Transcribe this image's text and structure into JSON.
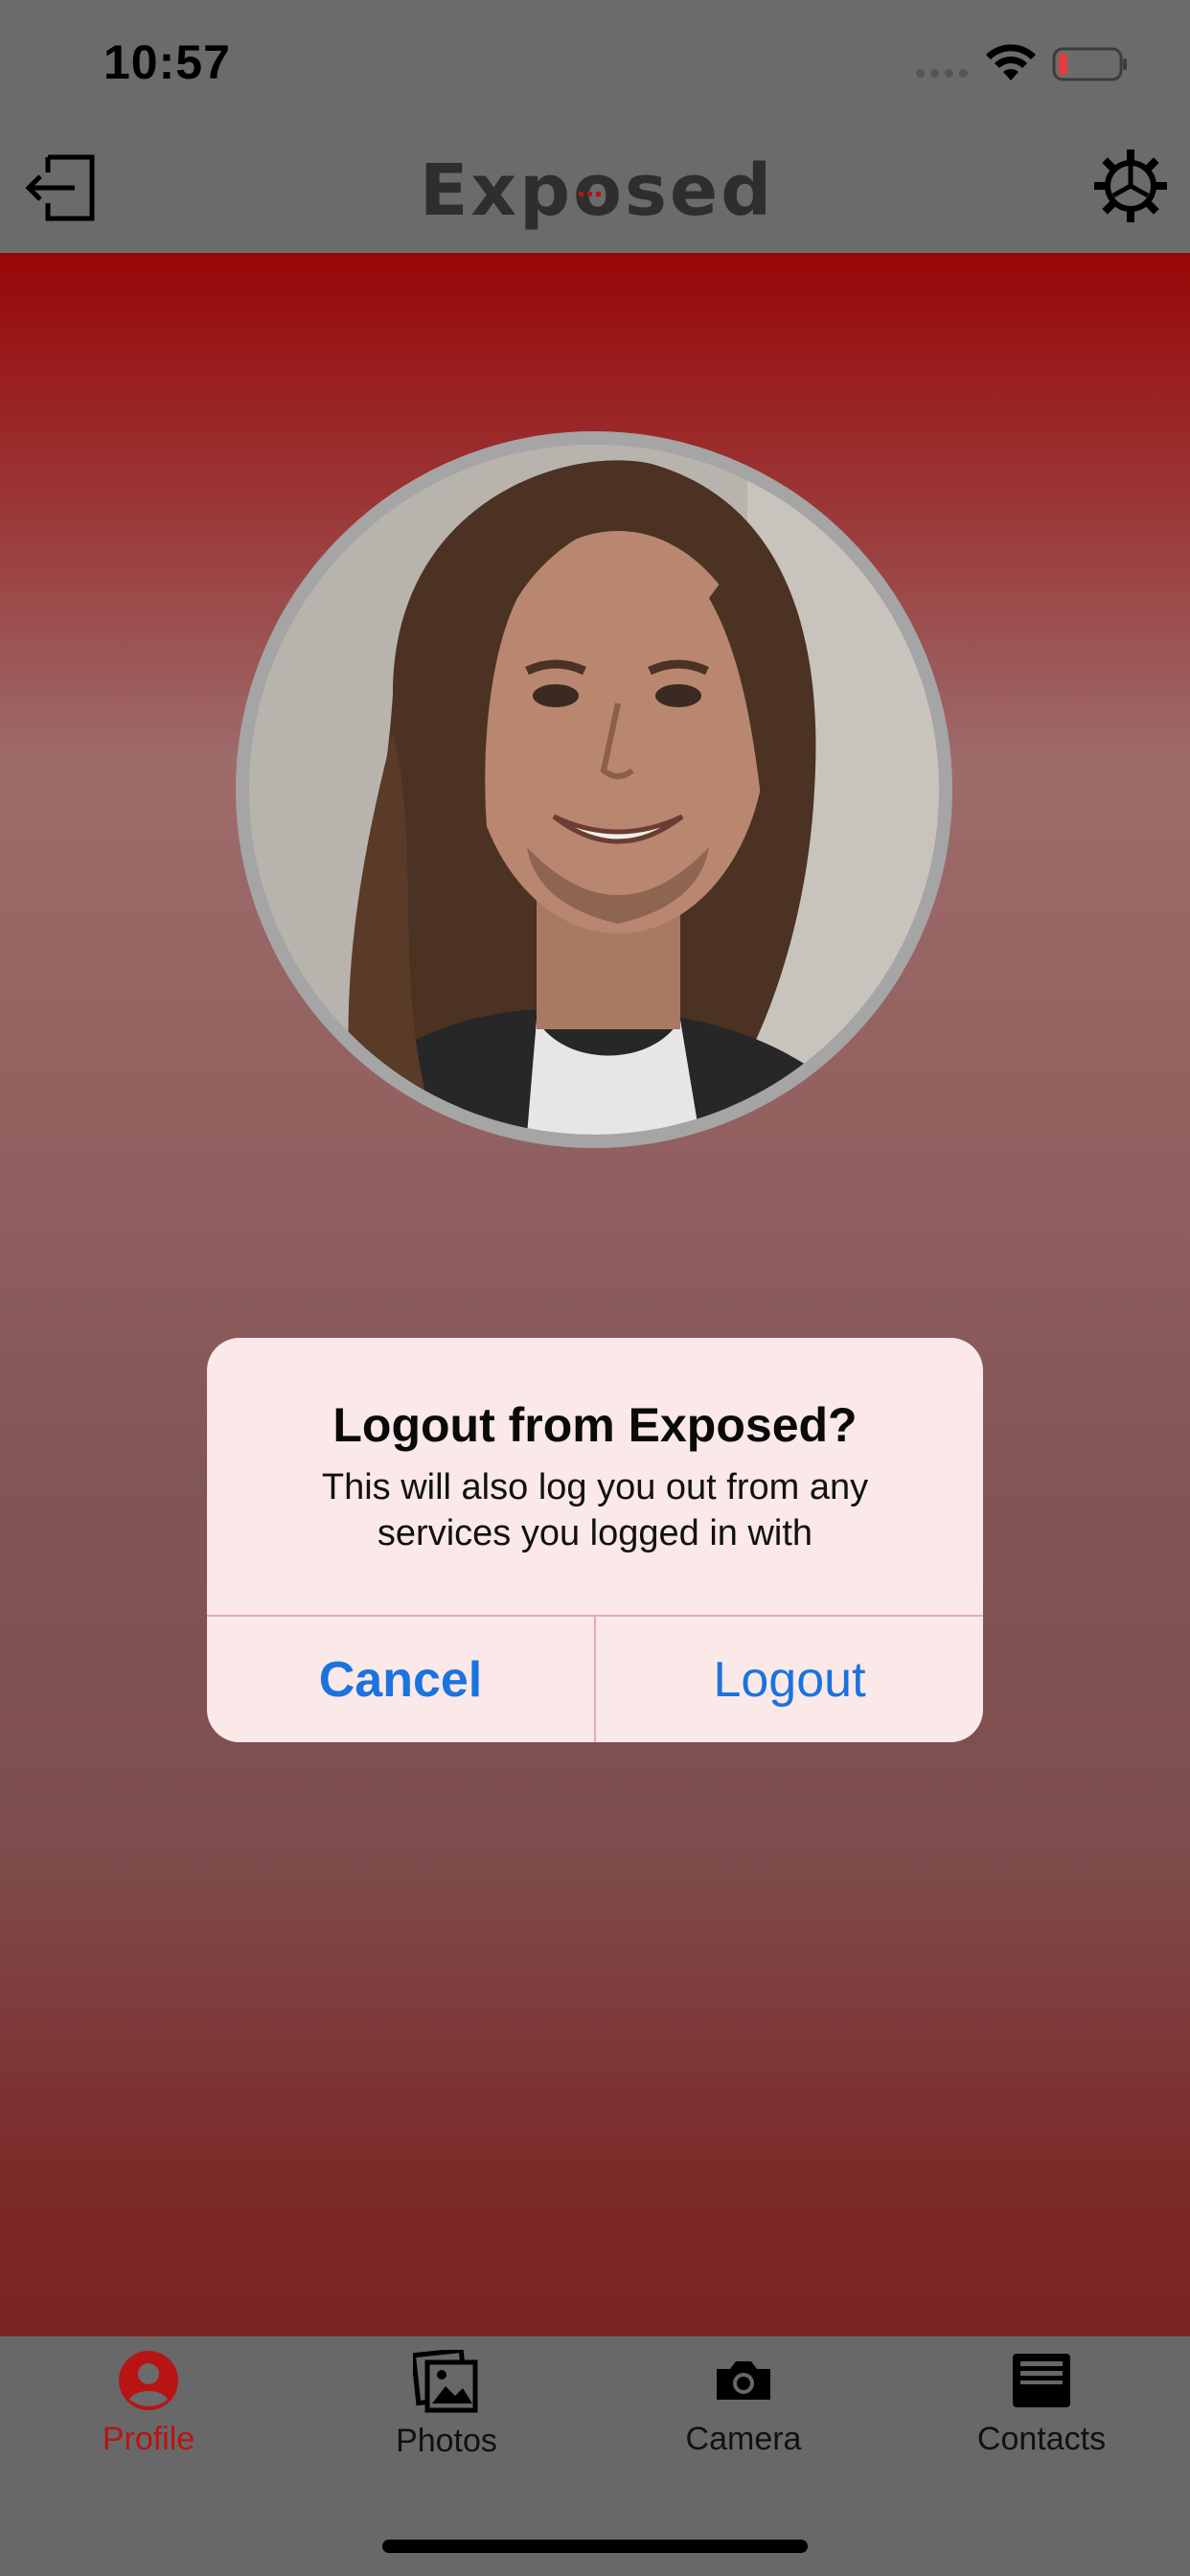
{
  "status_bar": {
    "time": "10:57"
  },
  "header": {
    "brand": "Exposed"
  },
  "alert": {
    "title": "Logout from Exposed?",
    "message": "This will also log you out from any services you logged in with",
    "cancel_label": "Cancel",
    "confirm_label": "Logout"
  },
  "tabs": [
    {
      "label": "Profile",
      "icon": "person-circle-icon",
      "active": true
    },
    {
      "label": "Photos",
      "icon": "photos-icon",
      "active": false
    },
    {
      "label": "Camera",
      "icon": "camera-icon",
      "active": false
    },
    {
      "label": "Contacts",
      "icon": "contacts-tray-icon",
      "active": false
    }
  ],
  "colors": {
    "accent_red": "#b81414",
    "link_blue": "#1a73df",
    "overlay_gray": "#6b6b6b"
  }
}
